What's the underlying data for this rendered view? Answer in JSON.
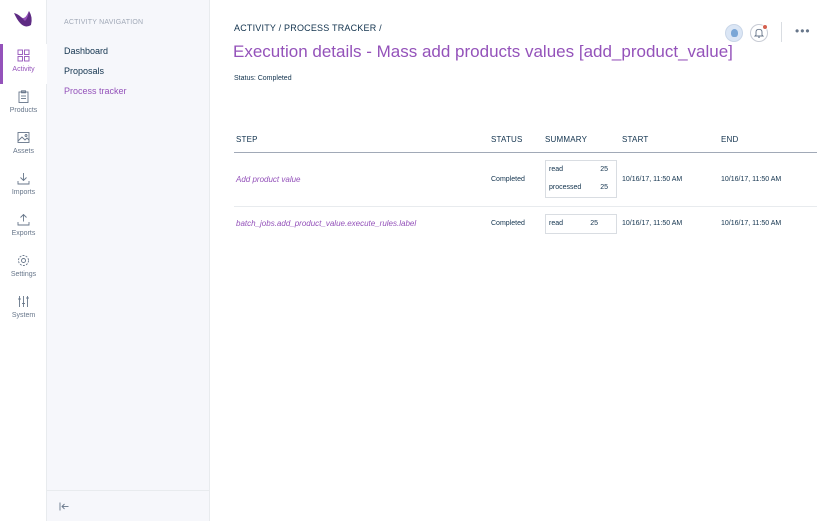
{
  "main_menu": [
    {
      "label": "Activity",
      "icon": "activity-icon",
      "active": true
    },
    {
      "label": "Products",
      "icon": "products-icon",
      "active": false
    },
    {
      "label": "Assets",
      "icon": "assets-icon",
      "active": false
    },
    {
      "label": "Imports",
      "icon": "imports-icon",
      "active": false
    },
    {
      "label": "Exports",
      "icon": "exports-icon",
      "active": false
    },
    {
      "label": "Settings",
      "icon": "settings-icon",
      "active": false
    },
    {
      "label": "System",
      "icon": "system-icon",
      "active": false
    }
  ],
  "sub_nav": {
    "title": "ACTIVITY NAVIGATION",
    "items": [
      {
        "label": "Dashboard",
        "active": false
      },
      {
        "label": "Proposals",
        "active": false
      },
      {
        "label": "Process tracker",
        "active": true
      }
    ]
  },
  "header": {
    "breadcrumb": "ACTIVITY / PROCESS TRACKER /",
    "title": "Execution details - Mass add products values [add_product_value]",
    "status": "Status: Completed"
  },
  "table": {
    "columns": [
      "STEP",
      "STATUS",
      "SUMMARY",
      "START",
      "END"
    ],
    "rows": [
      {
        "step": "Add product value",
        "status": "Completed",
        "summary": [
          {
            "key": "read",
            "value": "25"
          },
          {
            "key": "processed",
            "value": "25"
          }
        ],
        "start": "10/16/17, 11:50 AM",
        "end": "10/16/17, 11:50 AM"
      },
      {
        "step": "batch_jobs.add_product_value.execute_rules.label",
        "status": "Completed",
        "summary": [
          {
            "key": "read",
            "value": "25"
          }
        ],
        "start": "10/16/17, 11:50 AM",
        "end": "10/16/17, 11:50 AM"
      }
    ]
  },
  "colors": {
    "accent": "#9452ba",
    "text": "#11324d",
    "muted": "#67768a",
    "badge": "#d4604f"
  }
}
